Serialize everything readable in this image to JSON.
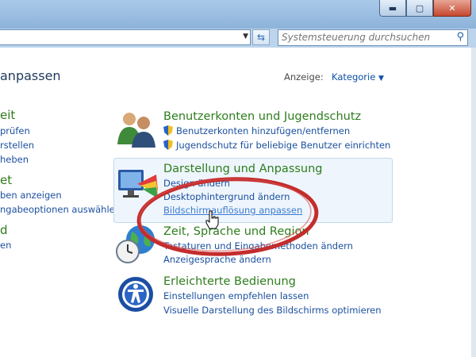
{
  "search": {
    "placeholder": "Systemsteuerung durchsuchen"
  },
  "header": {
    "title_partial": "anpassen",
    "view_label": "Anzeige:",
    "view_value": "Kategorie"
  },
  "left_column": {
    "sections": [
      {
        "heading": "eit",
        "links": [
          "prüfen",
          "rstellen",
          "heben"
        ]
      },
      {
        "heading": "et",
        "links": [
          "ben anzeigen",
          "ngabeoptionen auswählen"
        ]
      },
      {
        "heading": "d",
        "links": [
          "en"
        ]
      }
    ]
  },
  "categories": [
    {
      "title": "Benutzerkonten und Jugendschutz",
      "links": [
        "Benutzerkonten hinzufügen/entfernen",
        "Jugendschutz für beliebige Benutzer einrichten"
      ],
      "shielded": true,
      "icon": "users-icon"
    },
    {
      "title": "Darstellung und Anpassung",
      "links": [
        "Design ändern",
        "Desktophintergrund ändern",
        "Bildschirmauflösung anpassen"
      ],
      "icon": "display-icon",
      "highlighted": true
    },
    {
      "title": "Zeit, Sprache und Region",
      "links": [
        "Tastaturen und Eingabemethoden ändern",
        "Anzeigesprache ändern"
      ],
      "icon": "globe-clock-icon"
    },
    {
      "title": "Erleichterte Bedienung",
      "links": [
        "Einstellungen empfehlen lassen",
        "Visuelle Darstellung des Bildschirms optimieren"
      ],
      "icon": "accessibility-icon"
    }
  ],
  "colors": {
    "annotation": "#c42d2d",
    "category_title": "#2d7d1c",
    "link": "#1a4f9f"
  }
}
